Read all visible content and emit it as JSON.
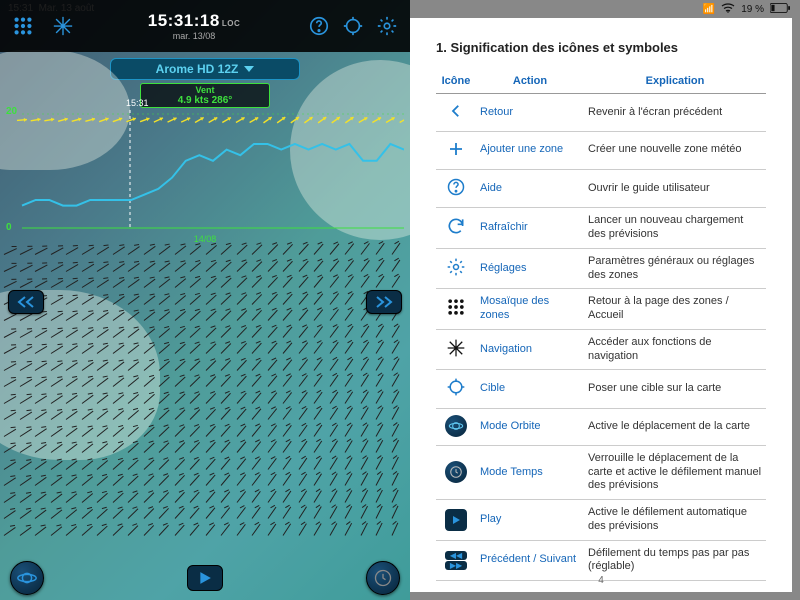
{
  "status": {
    "time": "15:31",
    "date_long": "Mar. 13 août",
    "battery": "19 %",
    "signal": "••ıl",
    "wifi": "✓"
  },
  "topbar": {
    "clock_time": "15:31:18",
    "clock_suffix": "LOC",
    "clock_date": "mar. 13/08"
  },
  "model": {
    "label": "Arome HD 12Z"
  },
  "wind": {
    "label": "Vent",
    "value": "4.9 kts 286°"
  },
  "chart_data": {
    "type": "line",
    "title": "",
    "xlabel": "",
    "ylabel": "",
    "ylim": [
      0,
      20
    ],
    "x_date_label": "14/08",
    "now_marker": "15:31",
    "series": [
      {
        "name": "wind_speed_kts",
        "values": [
          4,
          5,
          5,
          4,
          4,
          5,
          5,
          5,
          5,
          6,
          7,
          9,
          12,
          13,
          12,
          14,
          13,
          15,
          15,
          14,
          15,
          14,
          15,
          14,
          15,
          12,
          12,
          15,
          14
        ]
      }
    ],
    "wind_dir_row_deg": [
      265,
      260,
      260,
      255,
      255,
      255,
      250,
      250,
      250,
      250,
      245,
      245,
      245,
      240,
      240,
      240,
      240,
      240,
      235,
      235,
      235,
      235,
      235,
      235,
      235,
      240,
      240,
      240,
      240
    ]
  },
  "doc": {
    "heading": "1. Signification des icônes et symboles",
    "headers": {
      "icon": "Icône",
      "action": "Action",
      "explain": "Explication"
    },
    "rows": [
      {
        "icon": "back",
        "action": "Retour",
        "explain": "Revenir à l'écran précédent"
      },
      {
        "icon": "plus",
        "action": "Ajouter une zone",
        "explain": "Créer une nouvelle zone météo"
      },
      {
        "icon": "help",
        "action": "Aide",
        "explain": "Ouvrir le guide utilisateur"
      },
      {
        "icon": "refresh",
        "action": "Rafraîchir",
        "explain": "Lancer un nouveau chargement des prévisions"
      },
      {
        "icon": "settings",
        "action": "Réglages",
        "explain": "Paramètres généraux ou réglages des zones"
      },
      {
        "icon": "grid",
        "action": "Mosaïque des zones",
        "explain": "Retour à la page des zones / Accueil"
      },
      {
        "icon": "compass",
        "action": "Navigation",
        "explain": "Accéder aux fonctions de navigation"
      },
      {
        "icon": "target",
        "action": "Cible",
        "explain": "Poser une cible sur la carte"
      },
      {
        "icon": "orbit",
        "action": "Mode Orbite",
        "explain": "Active le déplacement de la carte"
      },
      {
        "icon": "time",
        "action": "Mode Temps",
        "explain": "Verrouille le déplacement de la carte et active le défilement manuel des prévisions"
      },
      {
        "icon": "play",
        "action": "Play",
        "explain": "Active le défilement automatique des prévisions"
      },
      {
        "icon": "prevnext",
        "action": "Précédent / Suivant",
        "explain": "Défilement du temps pas par pas (réglable)"
      }
    ],
    "page": "4"
  },
  "ios": {
    "battery_text": "19 %"
  }
}
